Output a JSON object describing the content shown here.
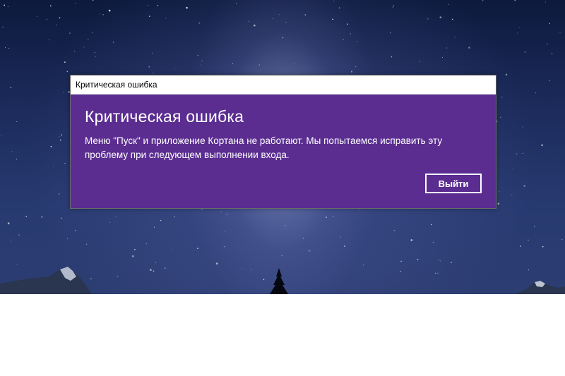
{
  "window": {
    "title": "Критическая ошибка"
  },
  "dialog": {
    "heading": "Критическая ошибка",
    "message": "Меню \"Пуск\" и приложение Кортана не работают. Мы попытаемся исправить эту проблему при следующем выполнении входа.",
    "exit_label": "Выйти",
    "accent_color": "#5b2d91"
  },
  "wallpaper": {
    "theme": "night-sky-milky-way",
    "color": "#1b2a5a"
  }
}
